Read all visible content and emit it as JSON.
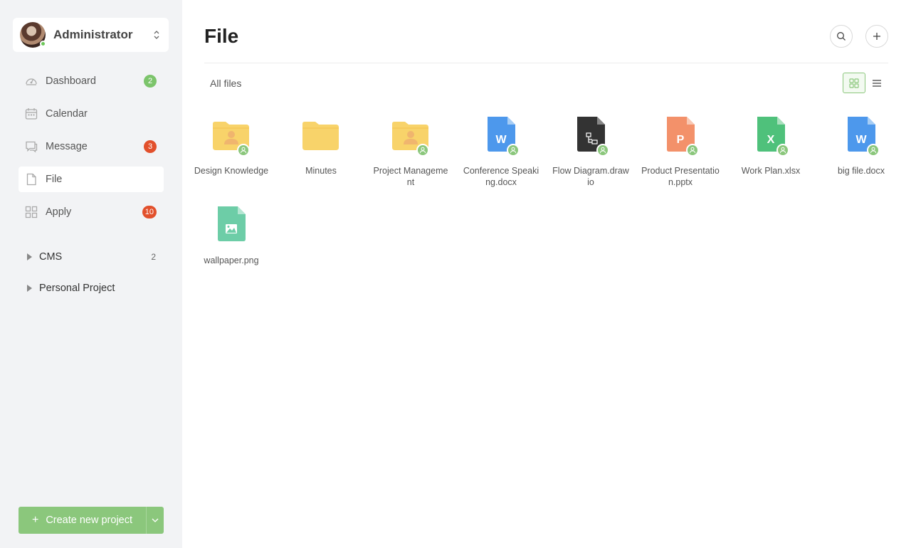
{
  "user": {
    "name": "Administrator"
  },
  "sidebar": {
    "items": [
      {
        "label": "Dashboard",
        "icon": "dashboard-icon",
        "badge": "2",
        "badge_color": "green"
      },
      {
        "label": "Calendar",
        "icon": "calendar-icon",
        "badge": ""
      },
      {
        "label": "Message",
        "icon": "message-icon",
        "badge": "3",
        "badge_color": "red"
      },
      {
        "label": "File",
        "icon": "file-icon",
        "badge": "",
        "active": true
      },
      {
        "label": "Apply",
        "icon": "apply-icon",
        "badge": "10",
        "badge_color": "red"
      }
    ],
    "groups": [
      {
        "label": "CMS",
        "count": "2"
      },
      {
        "label": "Personal Project",
        "count": ""
      }
    ],
    "create_label": "Create new project",
    "create_plus": "+"
  },
  "header": {
    "title": "File"
  },
  "breadcrumb": "All files",
  "colors": {
    "accent": "#8bc77c",
    "badge_red": "#e2502c",
    "badge_green": "#7cc46b",
    "folder": "#f8d36a",
    "word": "#4d98ec",
    "drawio": "#333333",
    "ppt": "#f3916a",
    "excel": "#4fc17b",
    "image": "#6dcda7"
  },
  "files": [
    {
      "name": "Design Knowledge",
      "type": "shared-folder",
      "shared": true
    },
    {
      "name": "Minutes",
      "type": "folder",
      "shared": false
    },
    {
      "name": "Project Management",
      "type": "shared-folder",
      "shared": true
    },
    {
      "name": "Conference Speaking.docx",
      "type": "word",
      "letter": "W",
      "shared": true
    },
    {
      "name": "Flow Diagram.drawio",
      "type": "drawio",
      "shared": true
    },
    {
      "name": "Product Presentation.pptx",
      "type": "ppt",
      "letter": "P",
      "shared": true
    },
    {
      "name": "Work Plan.xlsx",
      "type": "excel",
      "letter": "X",
      "shared": true
    },
    {
      "name": "big file.docx",
      "type": "word",
      "letter": "W",
      "shared": true
    },
    {
      "name": "wallpaper.png",
      "type": "image",
      "shared": false
    }
  ]
}
